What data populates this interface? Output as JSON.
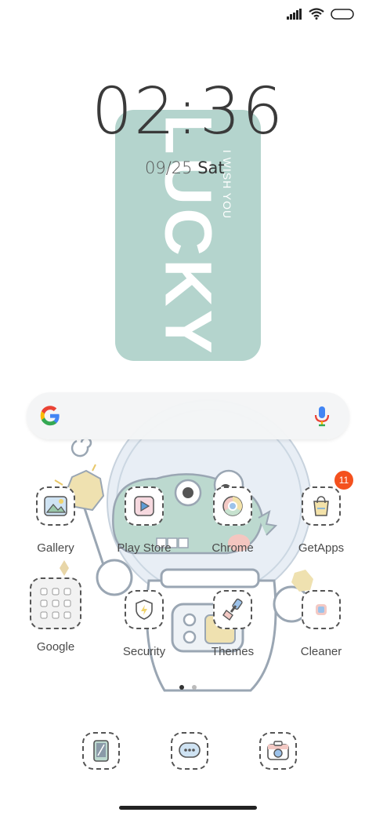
{
  "status_bar": {
    "icons": [
      "signal-icon",
      "wifi-icon",
      "battery-icon"
    ]
  },
  "wallpaper": {
    "card_text": "LUCKY",
    "card_subtext": "I WISH YOU",
    "card_color": "#b4d4cd"
  },
  "clock": {
    "time": "02:36",
    "date": "09/25",
    "weekday": "Sat"
  },
  "search_bar": {
    "logo": "google-g-icon",
    "mic": "mic-icon"
  },
  "apps": [
    {
      "label": "Gallery",
      "icon": "gallery-icon"
    },
    {
      "label": "Play Store",
      "icon": "play-store-icon"
    },
    {
      "label": "Chrome",
      "icon": "chrome-icon"
    },
    {
      "label": "GetApps",
      "icon": "getapps-icon",
      "badge": "11"
    },
    {
      "label": "Google",
      "icon": "google-folder-icon"
    },
    {
      "label": "Security",
      "icon": "security-icon"
    },
    {
      "label": "Themes",
      "icon": "themes-icon"
    },
    {
      "label": "Cleaner",
      "icon": "cleaner-icon"
    }
  ],
  "page_indicator": {
    "pages": 2,
    "current": 1
  },
  "dock": [
    {
      "icon": "phone-icon"
    },
    {
      "icon": "messages-icon"
    },
    {
      "icon": "camera-icon"
    }
  ],
  "colors": {
    "badge": "#f4511e",
    "accent_card": "#b4d4cd"
  }
}
